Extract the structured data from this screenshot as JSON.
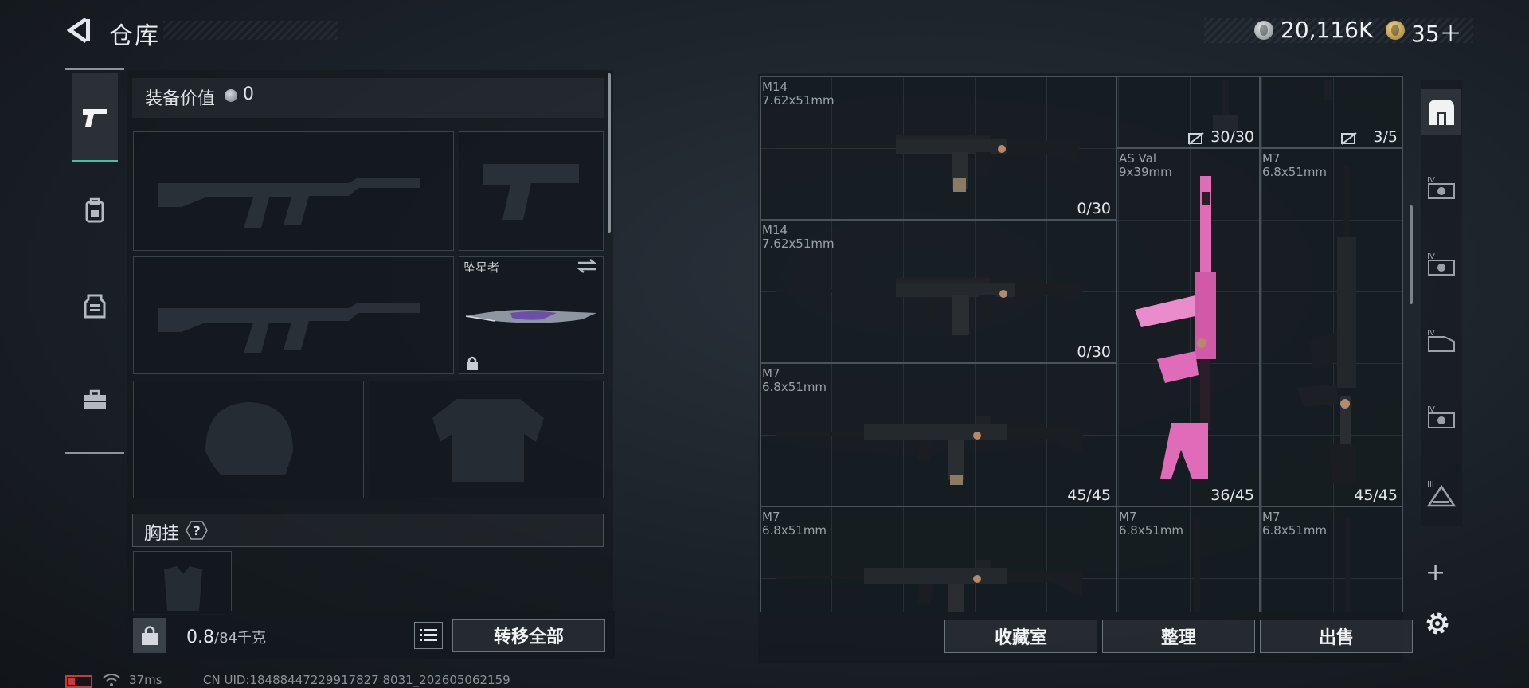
{
  "header": {
    "title": "仓库"
  },
  "currency": [
    {
      "icon": "silver-coin-icon",
      "value": "20,116K"
    },
    {
      "icon": "gold-coin-icon",
      "value": "35＋"
    }
  ],
  "categories": [
    {
      "name": "gun",
      "active": true
    },
    {
      "name": "backpack",
      "active": false
    },
    {
      "name": "vest",
      "active": false
    },
    {
      "name": "toolbox",
      "active": false
    }
  ],
  "loadout": {
    "equip_label": "装备价值",
    "equip_value": "0",
    "melee_name": "坠星者",
    "chest_label": "胸挂",
    "chest_help": "?",
    "weight_current": "0.8",
    "weight_max": "/84千克",
    "transfer_all": "转移全部"
  },
  "inventory": {
    "items": [
      {
        "name": "M14",
        "caliber": "7.62x51mm",
        "count": "0/30"
      },
      {
        "name": "",
        "caliber": "",
        "count": "30/30"
      },
      {
        "name": "",
        "caliber": "",
        "count": "3/5"
      },
      {
        "name": "AS Val",
        "caliber": "9x39mm",
        "count": "36/45"
      },
      {
        "name": "M7",
        "caliber": "6.8x51mm",
        "count": "45/45"
      },
      {
        "name": "M14",
        "caliber": "7.62x51mm",
        "count": "0/30"
      },
      {
        "name": "M7",
        "caliber": "6.8x51mm",
        "count": "45/45"
      },
      {
        "name": "M7",
        "caliber": "6.8x51mm",
        "count": ""
      },
      {
        "name": "M7",
        "caliber": "6.8x51mm",
        "count": ""
      },
      {
        "name": "M7",
        "caliber": "6.8x51mm",
        "count": ""
      }
    ],
    "buttons": {
      "collection": "收藏室",
      "organize": "整理",
      "sell": "出售"
    }
  },
  "filters": [
    {
      "icon": "all-items-icon",
      "active": true
    },
    {
      "icon": "tier-4-armor-icon",
      "label": "IV"
    },
    {
      "icon": "tier-4-helmet-icon",
      "label": "IV"
    },
    {
      "icon": "tier-4-rig-icon",
      "label": "IV"
    },
    {
      "icon": "tier-4-backpack-icon",
      "label": "IV"
    },
    {
      "icon": "tier-3-filter-icon",
      "label": "III"
    }
  ],
  "status": {
    "ping": "37ms",
    "uid": "CN UID:18488447229917827 8031_202605062159"
  },
  "colors": {
    "accent": "#41c6a1",
    "pink_skin": "#e06bb8",
    "battery_low": "#c63b3b"
  }
}
